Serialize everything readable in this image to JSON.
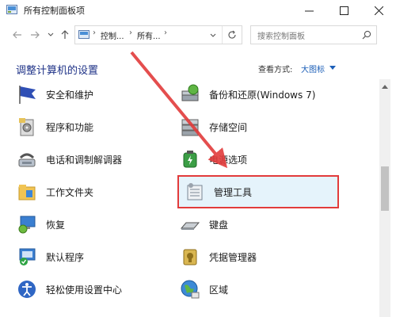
{
  "window": {
    "title": "所有控制面板项"
  },
  "address": {
    "seg1": "控制...",
    "seg2": "所有..."
  },
  "search": {
    "placeholder": "搜索控制面板"
  },
  "header": {
    "heading": "调整计算机的设置",
    "view_label": "查看方式:",
    "view_value": "大图标"
  },
  "items_left": [
    {
      "label": "安全和维护",
      "icon": "security-flag-icon"
    },
    {
      "label": "程序和功能",
      "icon": "programs-icon"
    },
    {
      "label": "电话和调制解调器",
      "icon": "phone-modem-icon"
    },
    {
      "label": "工作文件夹",
      "icon": "work-folders-icon"
    },
    {
      "label": "恢复",
      "icon": "recovery-icon"
    },
    {
      "label": "默认程序",
      "icon": "default-programs-icon"
    },
    {
      "label": "轻松使用设置中心",
      "icon": "ease-of-access-icon"
    }
  ],
  "items_right": [
    {
      "label": "备份和还原(Windows 7)",
      "icon": "backup-icon"
    },
    {
      "label": "存储空间",
      "icon": "storage-spaces-icon"
    },
    {
      "label": "电源选项",
      "icon": "power-options-icon"
    },
    {
      "label": "管理工具",
      "icon": "admin-tools-icon"
    },
    {
      "label": "键盘",
      "icon": "keyboard-icon"
    },
    {
      "label": "凭据管理器",
      "icon": "credential-manager-icon"
    },
    {
      "label": "区域",
      "icon": "region-icon"
    }
  ],
  "colors": {
    "heading": "#1e3287",
    "highlight_border": "#e23b3b",
    "selected_bg": "#e5f3fb",
    "arrow": "#e23b3b"
  }
}
